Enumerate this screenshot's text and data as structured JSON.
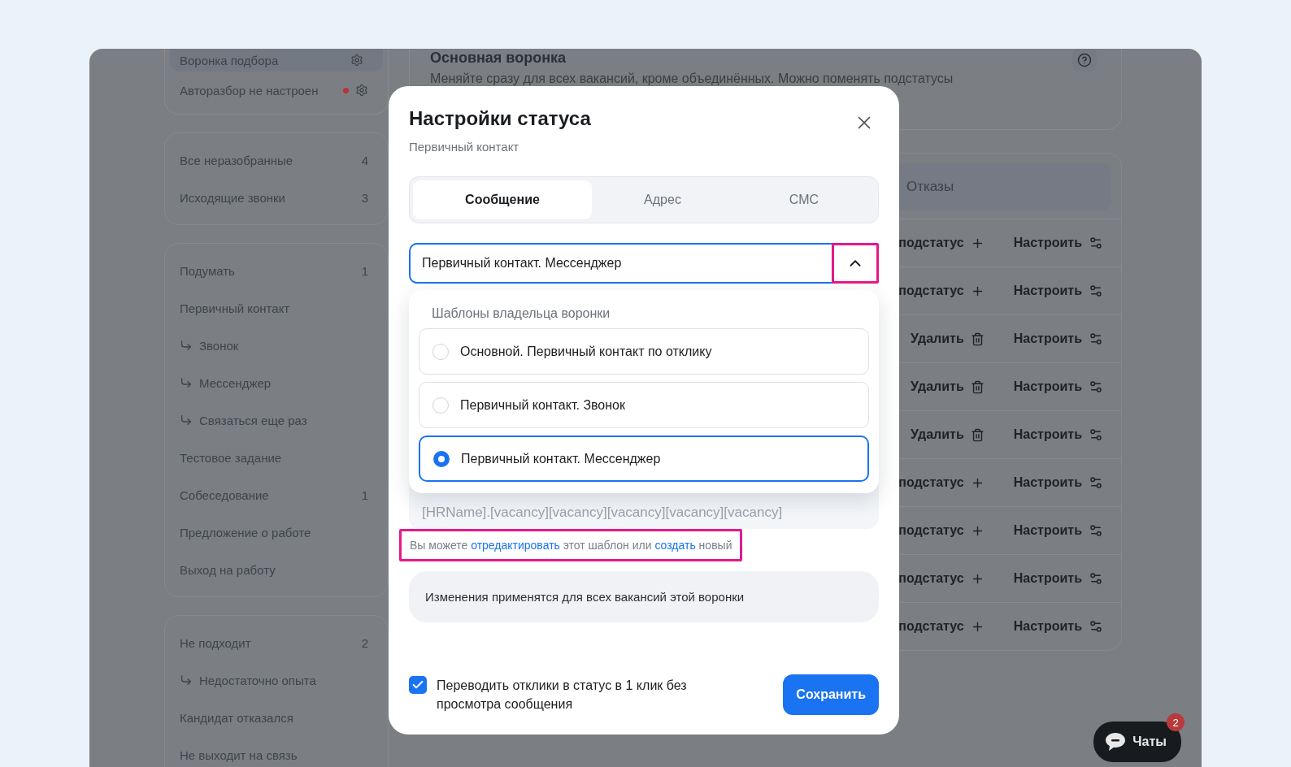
{
  "sidebar": {
    "groups": [
      {
        "items": [
          {
            "label": "Воронка подбора",
            "selected": true,
            "alert": false
          },
          {
            "label": "Авторазбор не настроен",
            "selected": false,
            "alert": true
          }
        ]
      },
      {
        "items": [
          {
            "label": "Все неразобранные",
            "count": "4",
            "selected": false
          },
          {
            "label": "Исходящие звонки",
            "count": "3",
            "selected": false
          }
        ]
      },
      {
        "items": [
          {
            "label": "Подумать",
            "count": "1",
            "selected": false
          },
          {
            "label": "Первичный контакт",
            "selected": false,
            "children": [
              {
                "label": "Звонок",
                "selected": false
              },
              {
                "label": "Мессенджер",
                "selected": false
              },
              {
                "label": "Связаться еще раз",
                "selected": false
              }
            ]
          },
          {
            "label": "Тестовое задание",
            "selected": false
          },
          {
            "label": "Собеседование",
            "count": "1",
            "selected": false
          },
          {
            "label": "Предложение о работе",
            "selected": false
          },
          {
            "label": "Выход на работу",
            "selected": false
          }
        ]
      },
      {
        "items": [
          {
            "label": "Не подходит",
            "count": "2",
            "selected": false,
            "children": [
              {
                "label": "Недостаточно опыта",
                "selected": false
              }
            ]
          },
          {
            "label": "Кандидат отказался",
            "selected": false
          },
          {
            "label": "Не выходит на связь",
            "selected": false
          }
        ]
      }
    ]
  },
  "main": {
    "title": "Основная воронка",
    "description": "Меняйте сразу для всех вакансий, кроме объединённых. Можно поменять подстатусы",
    "tabs": [
      {
        "label": "Отказы",
        "selected": false
      }
    ],
    "rows": [
      {
        "kind": "add",
        "action": "подстатус",
        "configure": "Настроить"
      },
      {
        "kind": "add",
        "action": "подстатус",
        "configure": "Настроить"
      },
      {
        "kind": "delete",
        "action": "Удалить",
        "configure": "Настроить"
      },
      {
        "kind": "delete",
        "action": "Удалить",
        "configure": "Настроить"
      },
      {
        "kind": "delete",
        "action": "Удалить",
        "configure": "Настроить"
      },
      {
        "kind": "add",
        "action": "подстатус",
        "configure": "Настроить"
      },
      {
        "kind": "add",
        "action": "подстатус",
        "configure": "Настроить"
      },
      {
        "kind": "add",
        "action": "подстатус",
        "configure": "Настроить"
      },
      {
        "kind": "add",
        "action": "подстатус",
        "configure": "Настроить"
      }
    ]
  },
  "modal": {
    "title": "Настройки статуса",
    "subtitle": "Первичный контакт",
    "tabs": [
      {
        "label": "Сообщение",
        "selected": true
      },
      {
        "label": "Адрес",
        "selected": false
      },
      {
        "label": "СМС",
        "selected": false
      }
    ],
    "select": {
      "value": "Первичный контакт. Мессенджер",
      "expanded": true,
      "highlighted": true
    },
    "dropdown": {
      "group_label": "Шаблоны владельца воронки",
      "options": [
        {
          "label": "Основной. Первичный контакт по отклику",
          "selected": false
        },
        {
          "label": "Первичный контакт. Звонок",
          "selected": false
        },
        {
          "label": "Первичный контакт. Мессенджер",
          "selected": true
        }
      ]
    },
    "template": {
      "text": "[HRName].[vacancy][vacancy][vacancy][vacancy][vacancy]"
    },
    "hint": {
      "highlighted": true,
      "parts": [
        {
          "text": "Вы можете ",
          "link": false
        },
        {
          "text": "отредактировать",
          "link": true
        },
        {
          "text": " этот шаблон или ",
          "link": false
        },
        {
          "text": "создать",
          "link": true
        },
        {
          "text": " новый",
          "link": false
        }
      ]
    },
    "info": "Изменения применятся для всех вакансий этой воронки",
    "checkbox": {
      "label": "Переводить отклики в статус в 1 клик без просмотра сообщения",
      "checked": true
    },
    "save_button": "Сохранить"
  },
  "chat": {
    "label": "Чаты",
    "badge": "2"
  }
}
